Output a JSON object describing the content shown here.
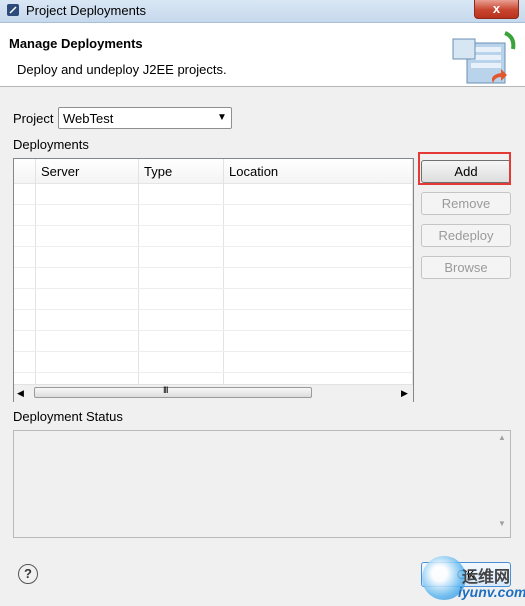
{
  "window": {
    "title": "Project Deployments",
    "close_glyph": "x"
  },
  "banner": {
    "title": "Manage Deployments",
    "description": "Deploy and undeploy J2EE projects."
  },
  "project": {
    "label": "Project",
    "selected": "WebTest"
  },
  "deployments": {
    "label": "Deployments",
    "columns": [
      "Server",
      "Type",
      "Location"
    ],
    "rows": [],
    "scroll_grip": "III"
  },
  "buttons": {
    "add": "Add",
    "remove": "Remove",
    "redeploy": "Redeploy",
    "browse": "Browse",
    "ok": "OK"
  },
  "status": {
    "label": "Deployment Status"
  },
  "help": {
    "glyph": "?"
  },
  "watermark": {
    "line1": "运维网",
    "line2": "iyunv.com"
  },
  "colors": {
    "highlight": "#e53935",
    "titlebar": "#c6d8ec",
    "ok_border": "#4a90d9"
  }
}
